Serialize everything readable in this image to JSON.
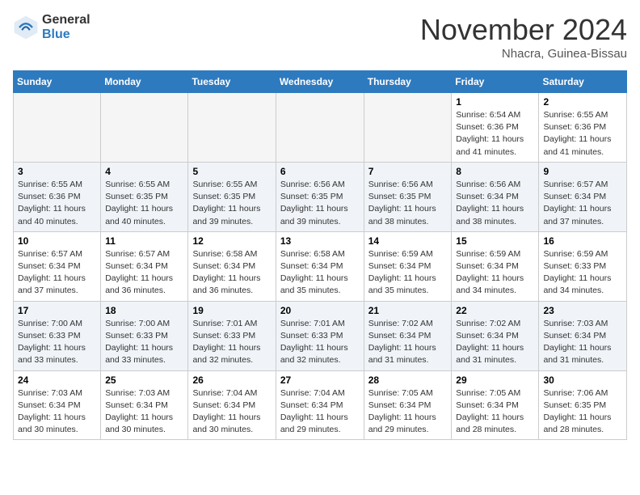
{
  "header": {
    "logo": {
      "general": "General",
      "blue": "Blue"
    },
    "title": "November 2024",
    "location": "Nhacra, Guinea-Bissau"
  },
  "days_of_week": [
    "Sunday",
    "Monday",
    "Tuesday",
    "Wednesday",
    "Thursday",
    "Friday",
    "Saturday"
  ],
  "weeks": [
    [
      {
        "day": "",
        "info": ""
      },
      {
        "day": "",
        "info": ""
      },
      {
        "day": "",
        "info": ""
      },
      {
        "day": "",
        "info": ""
      },
      {
        "day": "",
        "info": ""
      },
      {
        "day": "1",
        "info": "Sunrise: 6:54 AM\nSunset: 6:36 PM\nDaylight: 11 hours\nand 41 minutes."
      },
      {
        "day": "2",
        "info": "Sunrise: 6:55 AM\nSunset: 6:36 PM\nDaylight: 11 hours\nand 41 minutes."
      }
    ],
    [
      {
        "day": "3",
        "info": "Sunrise: 6:55 AM\nSunset: 6:36 PM\nDaylight: 11 hours\nand 40 minutes."
      },
      {
        "day": "4",
        "info": "Sunrise: 6:55 AM\nSunset: 6:35 PM\nDaylight: 11 hours\nand 40 minutes."
      },
      {
        "day": "5",
        "info": "Sunrise: 6:55 AM\nSunset: 6:35 PM\nDaylight: 11 hours\nand 39 minutes."
      },
      {
        "day": "6",
        "info": "Sunrise: 6:56 AM\nSunset: 6:35 PM\nDaylight: 11 hours\nand 39 minutes."
      },
      {
        "day": "7",
        "info": "Sunrise: 6:56 AM\nSunset: 6:35 PM\nDaylight: 11 hours\nand 38 minutes."
      },
      {
        "day": "8",
        "info": "Sunrise: 6:56 AM\nSunset: 6:34 PM\nDaylight: 11 hours\nand 38 minutes."
      },
      {
        "day": "9",
        "info": "Sunrise: 6:57 AM\nSunset: 6:34 PM\nDaylight: 11 hours\nand 37 minutes."
      }
    ],
    [
      {
        "day": "10",
        "info": "Sunrise: 6:57 AM\nSunset: 6:34 PM\nDaylight: 11 hours\nand 37 minutes."
      },
      {
        "day": "11",
        "info": "Sunrise: 6:57 AM\nSunset: 6:34 PM\nDaylight: 11 hours\nand 36 minutes."
      },
      {
        "day": "12",
        "info": "Sunrise: 6:58 AM\nSunset: 6:34 PM\nDaylight: 11 hours\nand 36 minutes."
      },
      {
        "day": "13",
        "info": "Sunrise: 6:58 AM\nSunset: 6:34 PM\nDaylight: 11 hours\nand 35 minutes."
      },
      {
        "day": "14",
        "info": "Sunrise: 6:59 AM\nSunset: 6:34 PM\nDaylight: 11 hours\nand 35 minutes."
      },
      {
        "day": "15",
        "info": "Sunrise: 6:59 AM\nSunset: 6:34 PM\nDaylight: 11 hours\nand 34 minutes."
      },
      {
        "day": "16",
        "info": "Sunrise: 6:59 AM\nSunset: 6:33 PM\nDaylight: 11 hours\nand 34 minutes."
      }
    ],
    [
      {
        "day": "17",
        "info": "Sunrise: 7:00 AM\nSunset: 6:33 PM\nDaylight: 11 hours\nand 33 minutes."
      },
      {
        "day": "18",
        "info": "Sunrise: 7:00 AM\nSunset: 6:33 PM\nDaylight: 11 hours\nand 33 minutes."
      },
      {
        "day": "19",
        "info": "Sunrise: 7:01 AM\nSunset: 6:33 PM\nDaylight: 11 hours\nand 32 minutes."
      },
      {
        "day": "20",
        "info": "Sunrise: 7:01 AM\nSunset: 6:33 PM\nDaylight: 11 hours\nand 32 minutes."
      },
      {
        "day": "21",
        "info": "Sunrise: 7:02 AM\nSunset: 6:34 PM\nDaylight: 11 hours\nand 31 minutes."
      },
      {
        "day": "22",
        "info": "Sunrise: 7:02 AM\nSunset: 6:34 PM\nDaylight: 11 hours\nand 31 minutes."
      },
      {
        "day": "23",
        "info": "Sunrise: 7:03 AM\nSunset: 6:34 PM\nDaylight: 11 hours\nand 31 minutes."
      }
    ],
    [
      {
        "day": "24",
        "info": "Sunrise: 7:03 AM\nSunset: 6:34 PM\nDaylight: 11 hours\nand 30 minutes."
      },
      {
        "day": "25",
        "info": "Sunrise: 7:03 AM\nSunset: 6:34 PM\nDaylight: 11 hours\nand 30 minutes."
      },
      {
        "day": "26",
        "info": "Sunrise: 7:04 AM\nSunset: 6:34 PM\nDaylight: 11 hours\nand 30 minutes."
      },
      {
        "day": "27",
        "info": "Sunrise: 7:04 AM\nSunset: 6:34 PM\nDaylight: 11 hours\nand 29 minutes."
      },
      {
        "day": "28",
        "info": "Sunrise: 7:05 AM\nSunset: 6:34 PM\nDaylight: 11 hours\nand 29 minutes."
      },
      {
        "day": "29",
        "info": "Sunrise: 7:05 AM\nSunset: 6:34 PM\nDaylight: 11 hours\nand 28 minutes."
      },
      {
        "day": "30",
        "info": "Sunrise: 7:06 AM\nSunset: 6:35 PM\nDaylight: 11 hours\nand 28 minutes."
      }
    ]
  ]
}
